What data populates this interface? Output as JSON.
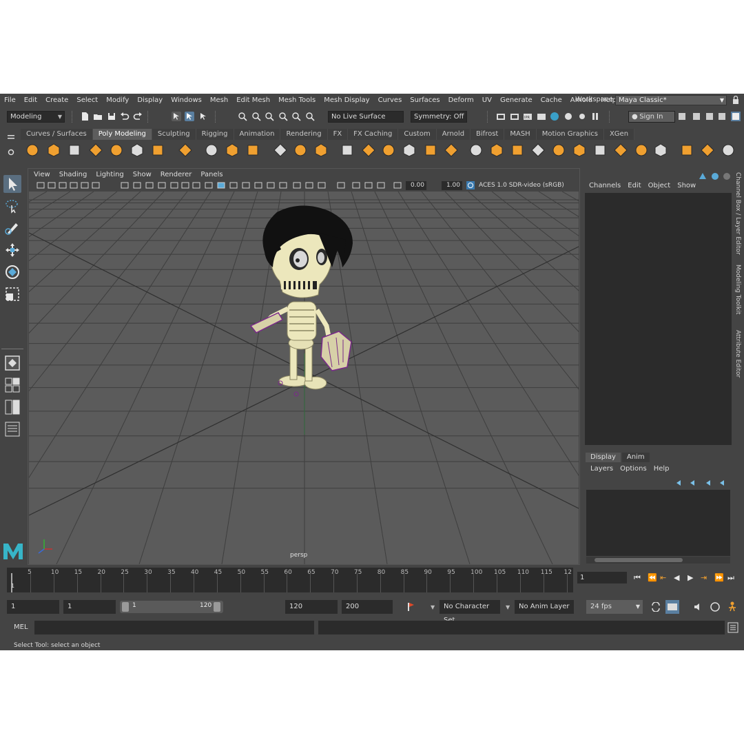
{
  "menu": [
    "File",
    "Edit",
    "Create",
    "Select",
    "Modify",
    "Display",
    "Windows",
    "Mesh",
    "Edit Mesh",
    "Mesh Tools",
    "Mesh Display",
    "Curves",
    "Surfaces",
    "Deform",
    "UV",
    "Generate",
    "Cache",
    "Arnold",
    "Help"
  ],
  "workspace": {
    "label": "Workspace :",
    "value": "Maya Classic*"
  },
  "status_line": {
    "menu_set": "Modeling",
    "live_surface": "No Live Surface",
    "symmetry": "Symmetry: Off",
    "sign_in": "Sign In"
  },
  "shelf_tabs": [
    "Curves / Surfaces",
    "Poly Modeling",
    "Sculpting",
    "Rigging",
    "Animation",
    "Rendering",
    "FX",
    "FX Caching",
    "Custom",
    "Arnold",
    "Bifrost",
    "MASH",
    "Motion Graphics",
    "XGen"
  ],
  "shelf_active": "Poly Modeling",
  "viewport": {
    "menu": [
      "View",
      "Shading",
      "Lighting",
      "Show",
      "Renderer",
      "Panels"
    ],
    "exposure": "0.00",
    "gamma": "1.00",
    "color_space": "ACES 1.0 SDR-video (sRGB)",
    "camera": "persp"
  },
  "channel_box": {
    "menu": [
      "Channels",
      "Edit",
      "Object",
      "Show"
    ]
  },
  "layer_editor": {
    "tabs": [
      "Display",
      "Anim"
    ],
    "menu": [
      "Layers",
      "Options",
      "Help"
    ]
  },
  "side_tabs": [
    "Channel Box / Layer Editor",
    "Modeling Toolkit",
    "Attribute Editor"
  ],
  "timeline": {
    "ticks": [
      "5",
      "10",
      "15",
      "20",
      "25",
      "30",
      "35",
      "40",
      "45",
      "50",
      "55",
      "60",
      "65",
      "70",
      "75",
      "80",
      "85",
      "90",
      "95",
      "100",
      "105",
      "110",
      "115",
      "12"
    ],
    "current_marker": "1",
    "current_frame": "1"
  },
  "range": {
    "start": "1",
    "playback_start": "1",
    "slider_min": "1",
    "slider_max": "120",
    "playback_end": "120",
    "end": "200",
    "character_set": "No Character Set",
    "anim_layer": "No Anim Layer",
    "fps": "24 fps"
  },
  "command_line": {
    "label": "MEL"
  },
  "help_line": "Select Tool: select an object",
  "colors": {
    "accent": "#f0a030",
    "viewport_bg": "#5b5b5b",
    "grid": "#3e3e3e",
    "selection": "#7a2a8a"
  }
}
